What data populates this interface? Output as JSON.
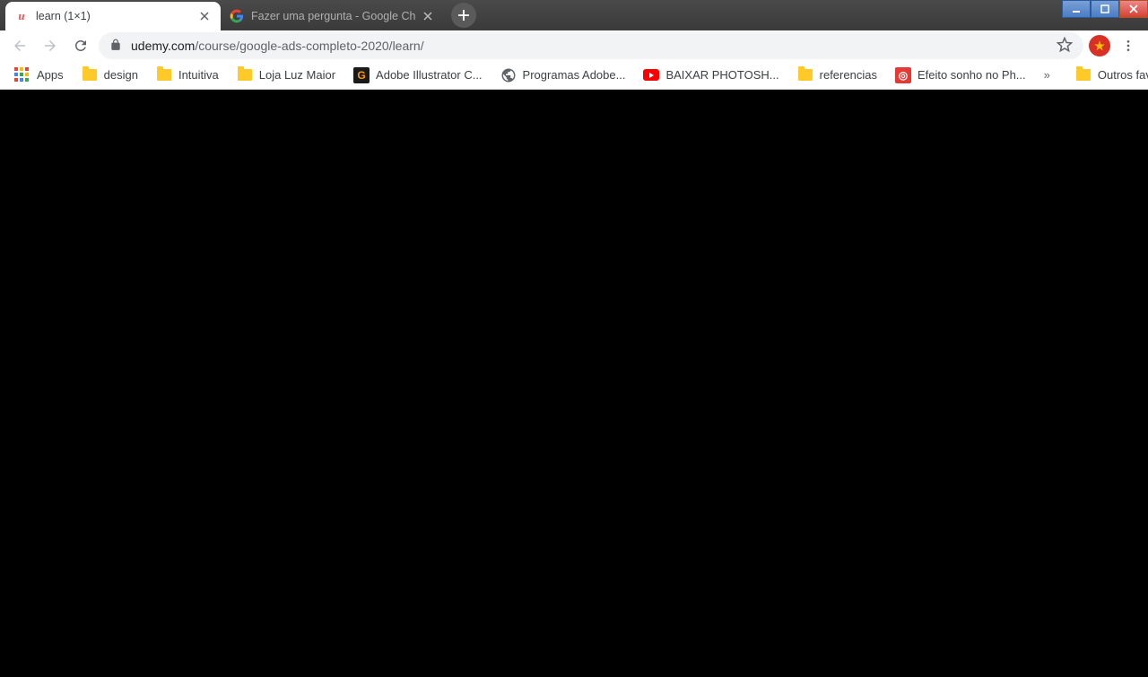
{
  "tabs": [
    {
      "title": "learn (1×1)"
    },
    {
      "title": "Fazer uma pergunta - Google Ch"
    }
  ],
  "url": {
    "domain": "udemy.com",
    "path": "/course/google-ads-completo-2020/learn/"
  },
  "bookmarks": {
    "apps": "Apps",
    "items": [
      {
        "label": "design"
      },
      {
        "label": "Intuitiva"
      },
      {
        "label": "Loja Luz Maior"
      },
      {
        "label": "Adobe Illustrator C..."
      },
      {
        "label": "Programas Adobe..."
      },
      {
        "label": "BAIXAR PHOTOSH..."
      },
      {
        "label": "referencias"
      },
      {
        "label": "Efeito sonho no Ph..."
      }
    ],
    "other": "Outros favoritos"
  }
}
